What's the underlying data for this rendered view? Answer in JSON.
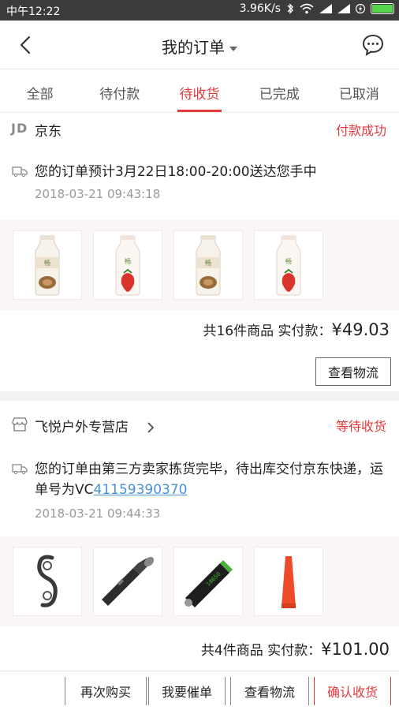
{
  "status_bar": {
    "time": "中午12:22",
    "net_speed": "3.96K/s",
    "battery_color": "#58d44a"
  },
  "nav": {
    "title": "我的订单"
  },
  "tabs": [
    {
      "label": "全部",
      "active": false
    },
    {
      "label": "待付款",
      "active": false
    },
    {
      "label": "待收货",
      "active": true
    },
    {
      "label": "已完成",
      "active": false
    },
    {
      "label": "已取消",
      "active": false
    }
  ],
  "orders": [
    {
      "shop_logo": "JD",
      "shop_name": "京东",
      "status": "付款成功",
      "message": "您的订单预计3月22日18:00-20:00送达您手中",
      "time": "2018-03-21 09:43:18",
      "goods": [
        "walnut-yogurt-bottle",
        "strawberry-yogurt-bottle",
        "walnut-yogurt-bottle",
        "strawberry-yogurt-bottle"
      ],
      "count_text": "共16件商品",
      "paid_label": "实付款：",
      "price": "¥49.03",
      "action": "查看物流"
    },
    {
      "shop_name": "飞悦户外专营店",
      "status": "等待收货",
      "message_prefix": "您的订单由第三方卖家拣货完毕，待出库交付京东快递，运单号为VC",
      "tracking_no": "41159390370",
      "time": "2018-03-21 09:44:33",
      "goods": [
        "s-carabiner",
        "flashlight",
        "battery-18650",
        "red-traffic-wand"
      ],
      "count_text": "共4件商品",
      "paid_label": "实付款：",
      "price": "¥101.00"
    }
  ],
  "bottom_actions": [
    "再次购买",
    "我要催单",
    "查看物流",
    "确认收货"
  ],
  "colors": {
    "accent": "#e4393c",
    "link": "#4a90d9"
  }
}
